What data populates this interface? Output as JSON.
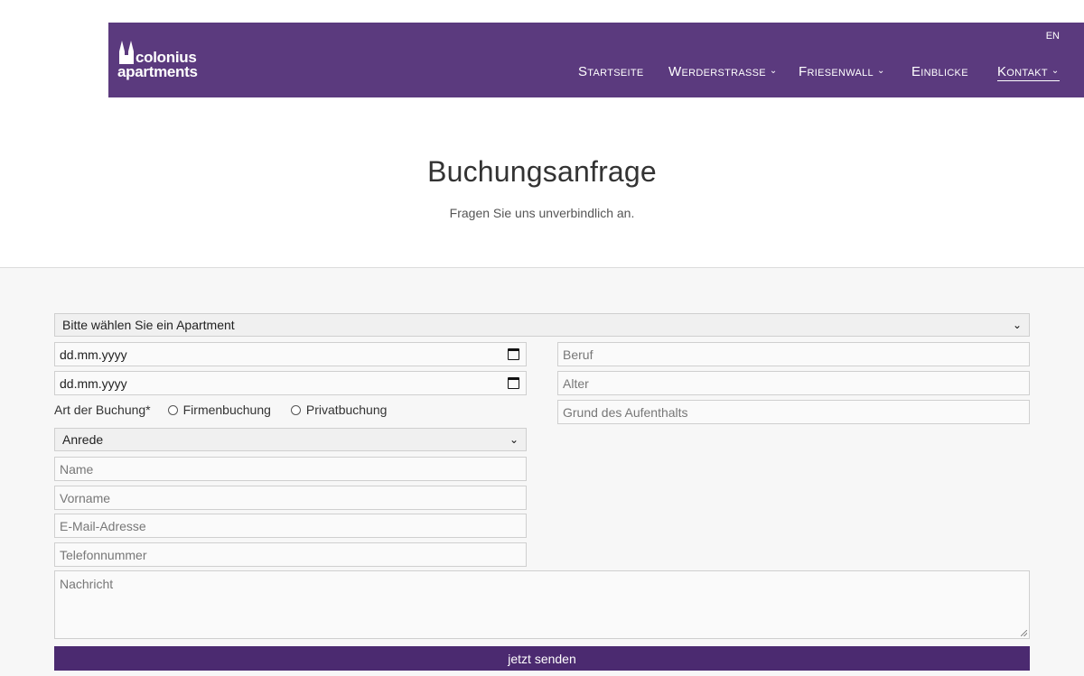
{
  "header": {
    "logo": {
      "line1": "colonius",
      "line2": "apartments"
    },
    "lang_switch": "EN",
    "nav": [
      {
        "label": "Startseite",
        "has_dropdown": false
      },
      {
        "label": "Werderstrasse",
        "has_dropdown": true
      },
      {
        "label": "Friesenwall",
        "has_dropdown": true
      },
      {
        "label": "Einblicke",
        "has_dropdown": false
      },
      {
        "label": "Kontakt",
        "has_dropdown": true,
        "active": true
      }
    ],
    "bg_color": "#5b3a7e"
  },
  "intro": {
    "title": "Buchungsanfrage",
    "subtitle": "Fragen Sie uns unverbindlich an."
  },
  "form": {
    "apartment_select": "Bitte wählen Sie ein Apartment",
    "date_from": "dd.mm.yyyy",
    "date_to": "dd.mm.yyyy",
    "booking_type_label": "Art der Buchung*",
    "booking_type_options": [
      "Firmenbuchung",
      "Privatbuchung"
    ],
    "salutation_select": "Anrede",
    "name_placeholder": "Name",
    "firstname_placeholder": "Vorname",
    "email_placeholder": "E-Mail-Adresse",
    "phone_placeholder": "Telefonnummer",
    "job_placeholder": "Beruf",
    "age_placeholder": "Alter",
    "reason_placeholder": "Grund des Aufenthalts",
    "message_placeholder": "Nachricht",
    "submit_label": "jetzt senden",
    "submit_color": "#4b2a70"
  }
}
